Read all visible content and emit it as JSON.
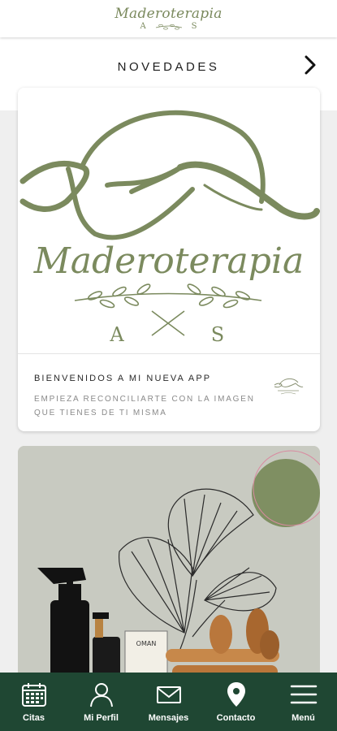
{
  "header": {
    "logo_word": "Maderoterapia",
    "logo_initial_left": "A",
    "logo_initial_right": "S"
  },
  "section": {
    "title": "NOVEDADES"
  },
  "post": {
    "hero_logo_word": "Maderoterapia",
    "hero_initial_left": "A",
    "hero_initial_right": "S",
    "title": "BIENVENIDOS A MI NUEVA APP",
    "subtitle": "EMPIEZA RECONCILIARTE CON LA IMAGEN QUE TIENES DE TI MISMA",
    "product_label": "OMAN"
  },
  "nav": {
    "items": [
      {
        "label": "Citas",
        "icon": "calendar-icon"
      },
      {
        "label": "Mi Perfil",
        "icon": "user-icon"
      },
      {
        "label": "Mensajes",
        "icon": "mail-icon"
      },
      {
        "label": "Contacto",
        "icon": "location-pin-icon"
      },
      {
        "label": "Menú",
        "icon": "menu-icon"
      }
    ]
  },
  "colors": {
    "brand_olive": "#7b8a5e",
    "nav_background": "#1f4733",
    "page_background": "#efefef"
  }
}
